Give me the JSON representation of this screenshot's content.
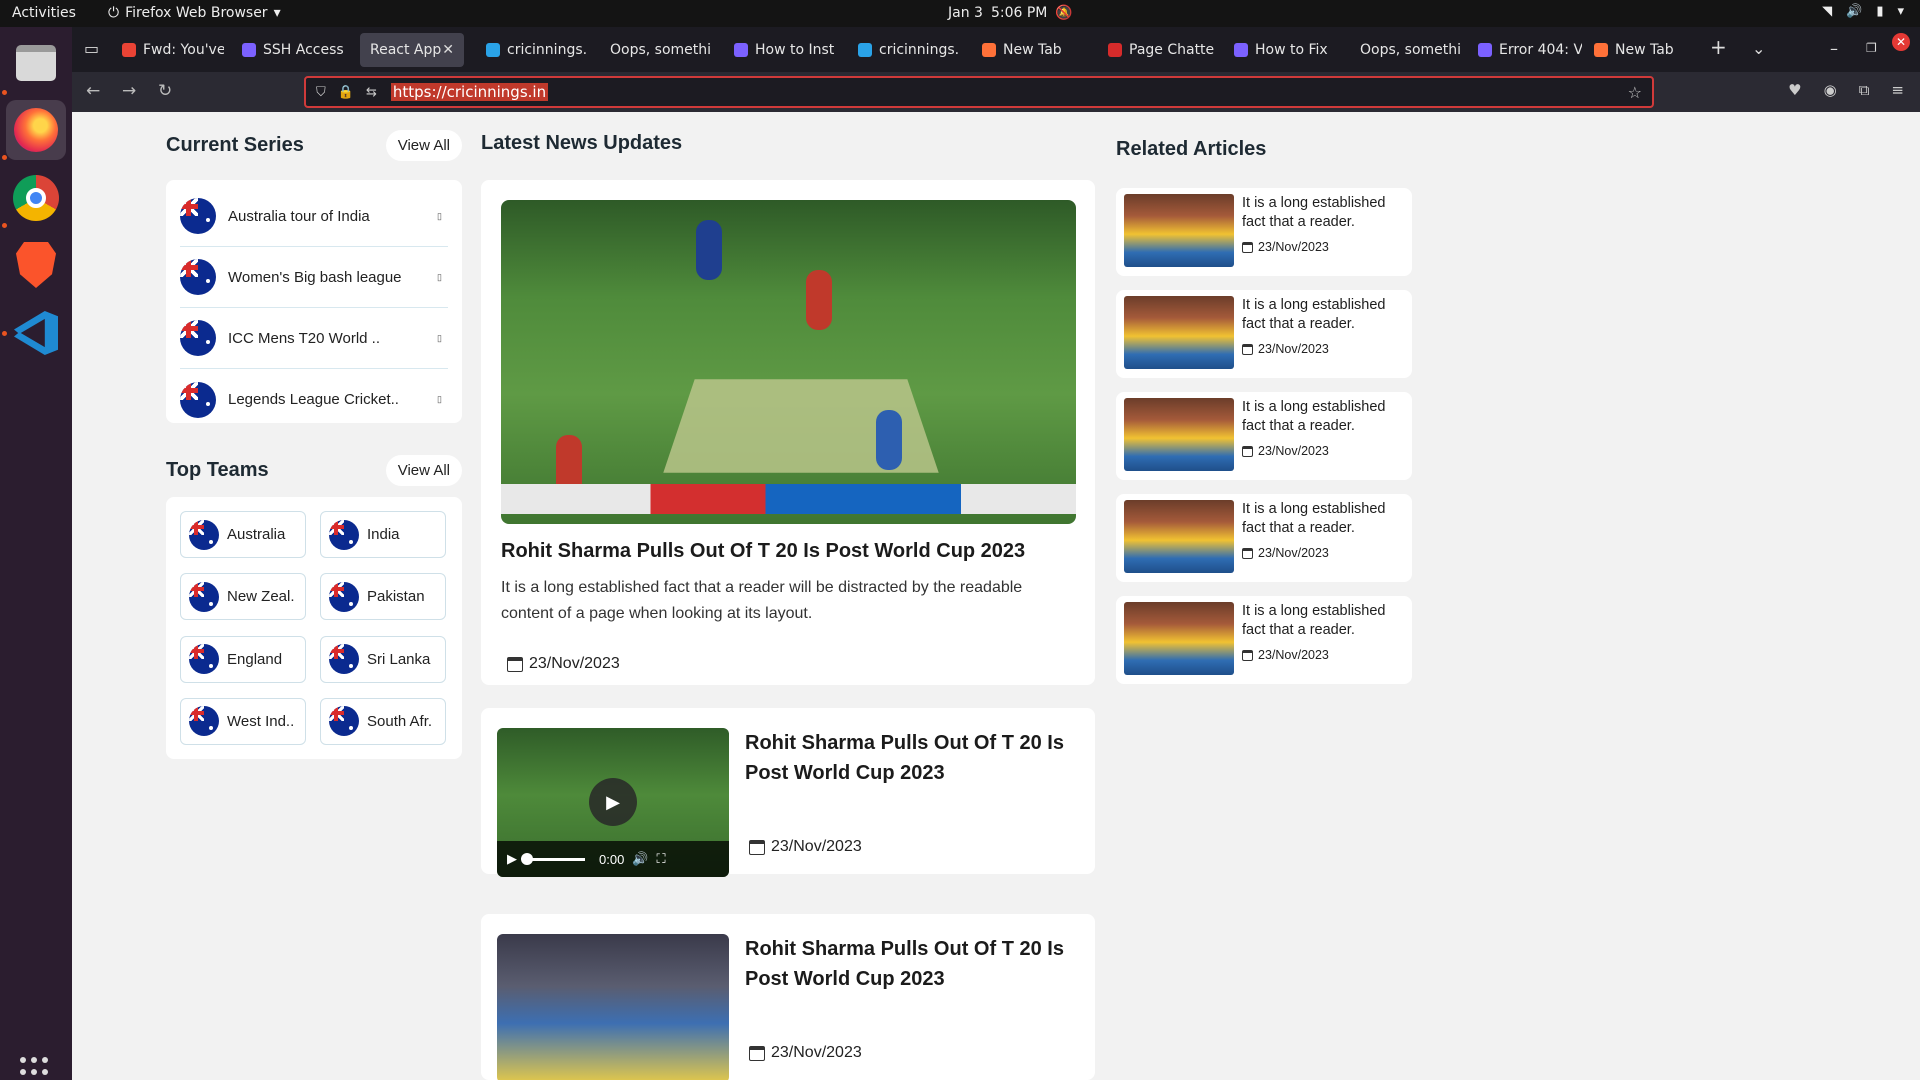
{
  "system": {
    "activities": "Activities",
    "app_name": "Firefox Web Browser",
    "date": "Jan 3",
    "time": "5:06 PM"
  },
  "browser": {
    "tabs": [
      {
        "label": "Fwd: You've",
        "favicon_color": "#ea4335"
      },
      {
        "label": "SSH Access",
        "favicon_color": "#7b61ff"
      },
      {
        "label": "React App",
        "favicon_color": "",
        "active": true
      },
      {
        "label": "cricinnings.",
        "favicon_color": "#2aa3e8"
      },
      {
        "label": "Oops, somethi",
        "favicon_color": ""
      },
      {
        "label": "How to Inst",
        "favicon_color": "#7b61ff"
      },
      {
        "label": "cricinnings.",
        "favicon_color": "#2aa3e8"
      },
      {
        "label": "New Tab",
        "favicon_color": "#ff7139"
      },
      {
        "label": "Page Chatte",
        "favicon_color": "#d62b2b"
      },
      {
        "label": "How to Fix",
        "favicon_color": "#7b61ff"
      },
      {
        "label": "Oops, somethi",
        "favicon_color": ""
      },
      {
        "label": "Error 404: V",
        "favicon_color": "#7b61ff"
      },
      {
        "label": "New Tab",
        "favicon_color": "#ff7139"
      }
    ],
    "url": "https://cricinnings.in"
  },
  "current_series": {
    "title": "Current Series",
    "view_all": "View All",
    "items": [
      "Australia tour of India",
      "Women's Big bash league",
      "ICC Mens T20 World ..",
      "Legends League Cricket.."
    ]
  },
  "top_teams": {
    "title": "Top Teams",
    "view_all": "View All",
    "items": [
      "Australia",
      "India",
      "New Zeal.",
      "Pakistan",
      "England",
      "Sri Lanka",
      "West Ind..",
      "South Afr."
    ]
  },
  "latest_news": {
    "title": "Latest News Updates",
    "feature": {
      "headline": "Rohit Sharma Pulls Out Of T 20 Is Post World Cup 2023",
      "summary": "It is a long established fact that a reader will be distracted by the readable content of a page when looking at its layout.",
      "date": "23/Nov/2023"
    },
    "items": [
      {
        "headline": "Rohit Sharma Pulls Out Of T 20 Is Post World Cup 2023",
        "date": "23/Nov/2023",
        "video_time": "0:00"
      },
      {
        "headline": "Rohit Sharma Pulls Out Of T 20 Is Post World Cup 2023",
        "date": "23/Nov/2023"
      }
    ]
  },
  "related_articles": {
    "title": "Related Articles",
    "items": [
      {
        "title": "It is a long established fact that a reader.",
        "date": "23/Nov/2023"
      },
      {
        "title": "It is a long established fact that a reader.",
        "date": "23/Nov/2023"
      },
      {
        "title": "It is a long established fact that a reader.",
        "date": "23/Nov/2023"
      },
      {
        "title": "It is a long established fact that a reader.",
        "date": "23/Nov/2023"
      },
      {
        "title": "It is a long established fact that a reader.",
        "date": "23/Nov/2023"
      }
    ]
  }
}
